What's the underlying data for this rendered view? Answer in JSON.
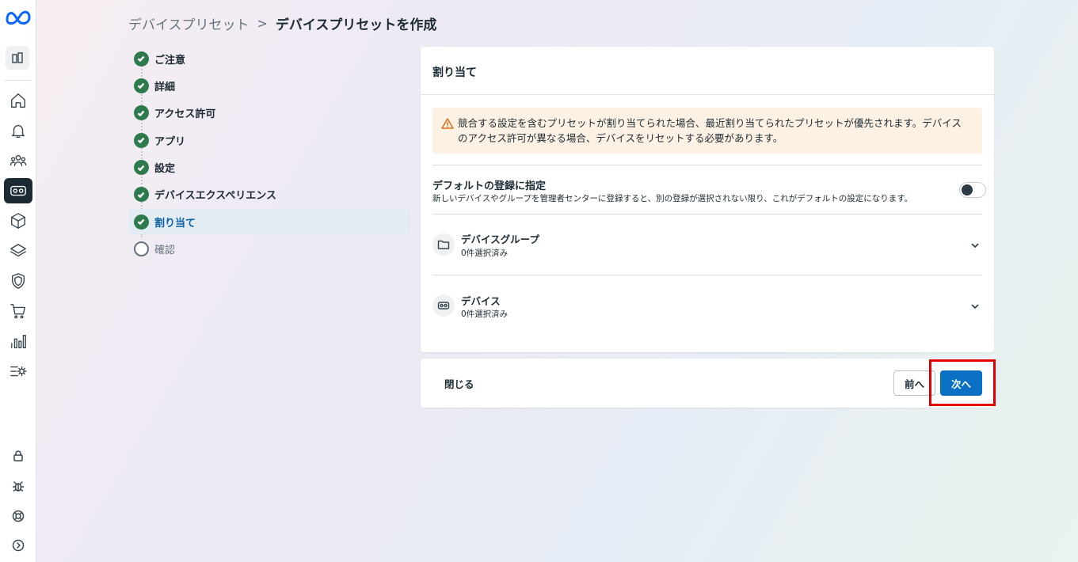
{
  "breadcrumb": {
    "parent": "デバイスプリセット",
    "separator": ">",
    "current": "デバイスプリセットを作成"
  },
  "steps": [
    {
      "label": "ご注意",
      "status": "done"
    },
    {
      "label": "詳細",
      "status": "done"
    },
    {
      "label": "アクセス許可",
      "status": "done"
    },
    {
      "label": "アプリ",
      "status": "done"
    },
    {
      "label": "設定",
      "status": "done"
    },
    {
      "label": "デバイスエクスペリエンス",
      "status": "done"
    },
    {
      "label": "割り当て",
      "status": "current"
    },
    {
      "label": "確認",
      "status": "pending"
    }
  ],
  "card": {
    "title": "割り当て",
    "warning_line1": "競合する設定を含むプリセットが割り当てられた場合、最近割り当てられたプリセットが優先されます。デバイス",
    "warning_line2": "のアクセス許可が異なる場合、デバイスをリセットする必要があります。",
    "default_title": "デフォルトの登録に指定",
    "default_desc": "新しいデバイスやグループを管理者センターに登録すると、別の登録が選択されない限り、これがデフォルトの設定になります。",
    "default_enabled": false,
    "device_groups": {
      "title": "デバイスグループ",
      "subtitle": "0件選択済み"
    },
    "devices": {
      "title": "デバイス",
      "subtitle": "0件選択済み"
    }
  },
  "footer": {
    "close_label": "閉じる",
    "prev_label": "前へ",
    "next_label": "次へ"
  },
  "colors": {
    "primary_button": "#0a70c4",
    "step_done": "#2d7a4d",
    "warning_bg": "#fdf1e4",
    "highlight": "#e00000"
  }
}
